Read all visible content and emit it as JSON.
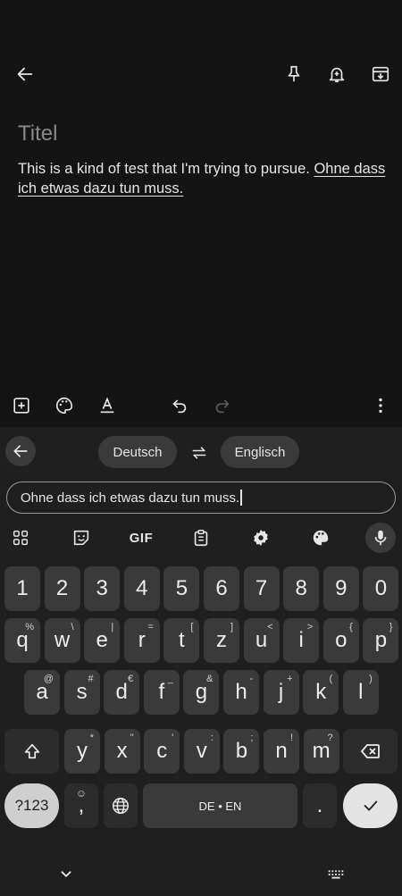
{
  "note": {
    "title_placeholder": "Titel",
    "body_plain": "This is a kind of test that I'm trying to pursue. ",
    "body_translated": "Ohne dass ich etwas dazu tun muss."
  },
  "translate": {
    "source_lang": "Deutsch",
    "target_lang": "Englisch",
    "input_value": "Ohne dass ich etwas dazu tun muss."
  },
  "toolbar": {
    "gif_label": "GIF"
  },
  "keyboard": {
    "number_row": [
      "1",
      "2",
      "3",
      "4",
      "5",
      "6",
      "7",
      "8",
      "9",
      "0"
    ],
    "row1": [
      {
        "k": "q",
        "h": "%"
      },
      {
        "k": "w",
        "h": "\\"
      },
      {
        "k": "e",
        "h": "|"
      },
      {
        "k": "r",
        "h": "="
      },
      {
        "k": "t",
        "h": "["
      },
      {
        "k": "z",
        "h": "]"
      },
      {
        "k": "u",
        "h": "<"
      },
      {
        "k": "i",
        "h": ">"
      },
      {
        "k": "o",
        "h": "{"
      },
      {
        "k": "p",
        "h": "}"
      }
    ],
    "row2": [
      {
        "k": "a",
        "h": "@"
      },
      {
        "k": "s",
        "h": "#"
      },
      {
        "k": "d",
        "h": "€"
      },
      {
        "k": "f",
        "h": "_"
      },
      {
        "k": "g",
        "h": "&"
      },
      {
        "k": "h",
        "h": "-"
      },
      {
        "k": "j",
        "h": "+"
      },
      {
        "k": "k",
        "h": "("
      },
      {
        "k": "l",
        "h": ")"
      }
    ],
    "row3": [
      {
        "k": "y",
        "h": "*"
      },
      {
        "k": "x",
        "h": "\""
      },
      {
        "k": "c",
        "h": "'"
      },
      {
        "k": "v",
        "h": ":"
      },
      {
        "k": "b",
        "h": ";"
      },
      {
        "k": "n",
        "h": "!"
      },
      {
        "k": "m",
        "h": "?"
      }
    ],
    "sym_label": "?123",
    "comma": ",",
    "space_label": "DE • EN",
    "period": "."
  }
}
